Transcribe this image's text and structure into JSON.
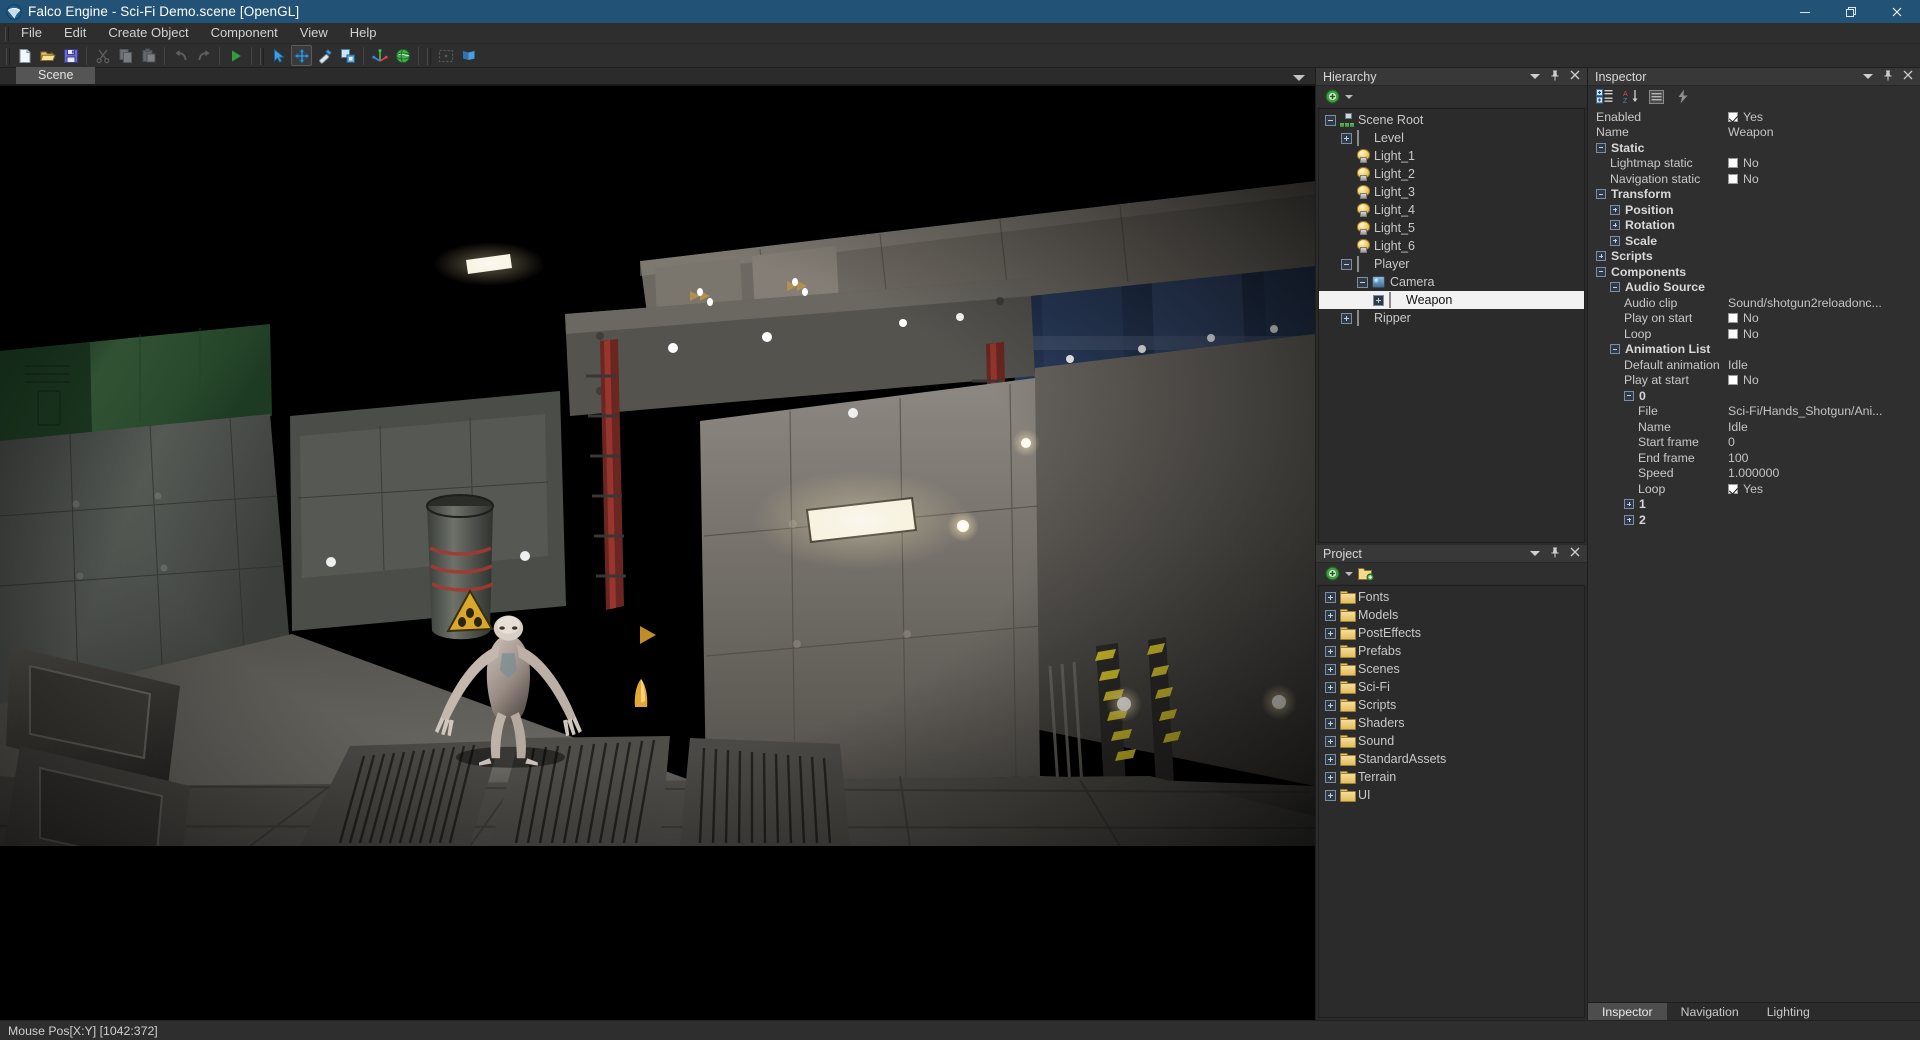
{
  "window": {
    "title": "Falco Engine - Sci-Fi Demo.scene [OpenGL]",
    "logo_icon": "falco-engine-logo-icon",
    "minimize_label": "—",
    "maximize_label": "❐",
    "close_label": "✕",
    "titlebar_color": "#225376"
  },
  "menu": {
    "items": [
      {
        "label": "File"
      },
      {
        "label": "Edit"
      },
      {
        "label": "Create Object"
      },
      {
        "label": "Component"
      },
      {
        "label": "View"
      },
      {
        "label": "Help"
      }
    ]
  },
  "toolbar": {
    "groups": [
      {
        "buttons": [
          {
            "name": "new-scene",
            "icon": "new-document-icon",
            "enabled": true
          },
          {
            "name": "open-scene",
            "icon": "open-folder-icon",
            "enabled": true
          },
          {
            "name": "save-scene",
            "icon": "floppy-save-icon",
            "enabled": true
          }
        ]
      },
      {
        "buttons": [
          {
            "name": "cut",
            "icon": "scissors-icon",
            "enabled": false
          },
          {
            "name": "copy",
            "icon": "copy-icon",
            "enabled": false
          },
          {
            "name": "paste",
            "icon": "paste-icon",
            "enabled": false
          }
        ]
      },
      {
        "buttons": [
          {
            "name": "undo",
            "icon": "undo-arrow-icon",
            "enabled": false
          },
          {
            "name": "redo",
            "icon": "redo-arrow-icon",
            "enabled": false
          }
        ]
      },
      {
        "buttons": [
          {
            "name": "play",
            "icon": "play-triangle-icon",
            "enabled": true
          }
        ]
      },
      {
        "buttons": [
          {
            "name": "select-tool",
            "icon": "cursor-arrow-icon",
            "enabled": true
          },
          {
            "name": "move-tool",
            "icon": "move-arrows-icon",
            "enabled": true,
            "active": true
          },
          {
            "name": "rotate-tool",
            "icon": "rotate-tool-icon",
            "enabled": true
          },
          {
            "name": "scale-tool",
            "icon": "scale-tool-icon",
            "enabled": true
          }
        ]
      },
      {
        "buttons": [
          {
            "name": "pivot-space",
            "icon": "axis-gizmo-icon",
            "enabled": true
          },
          {
            "name": "global-space",
            "icon": "globe-icon",
            "enabled": true
          }
        ]
      },
      {
        "buttons": [
          {
            "name": "rect-select",
            "icon": "marquee-select-icon",
            "enabled": false
          },
          {
            "name": "layers",
            "icon": "flag-icon",
            "enabled": true
          }
        ]
      }
    ]
  },
  "scene": {
    "tabs": [
      {
        "label": "Scene",
        "active": true
      }
    ],
    "dropdown_icon": "chevron-down-icon"
  },
  "hierarchy": {
    "title": "Hierarchy",
    "header_buttons": [
      {
        "name": "panel-menu",
        "icon": "chevron-down-icon"
      },
      {
        "name": "panel-pin",
        "icon": "pin-icon",
        "glyph": "⚐"
      },
      {
        "name": "panel-close",
        "icon": "close-icon",
        "glyph": "✕"
      }
    ],
    "tools": [
      {
        "name": "add-object",
        "icon": "add-green-circle-icon"
      },
      {
        "name": "add-object-menu",
        "icon": "chevron-down-icon"
      }
    ],
    "tree": [
      {
        "label": "Scene Root",
        "indent": 0,
        "toggle": "minus",
        "icon": "scene-root-icon",
        "selected": false
      },
      {
        "label": "Level",
        "indent": 1,
        "toggle": "plus",
        "icon": "gameobject-cube-icon",
        "selected": false
      },
      {
        "label": "Light_1",
        "indent": 1,
        "toggle": "none",
        "icon": "light-bulb-icon",
        "selected": false
      },
      {
        "label": "Light_2",
        "indent": 1,
        "toggle": "none",
        "icon": "light-bulb-icon",
        "selected": false
      },
      {
        "label": "Light_3",
        "indent": 1,
        "toggle": "none",
        "icon": "light-bulb-icon",
        "selected": false
      },
      {
        "label": "Light_4",
        "indent": 1,
        "toggle": "none",
        "icon": "light-bulb-icon",
        "selected": false
      },
      {
        "label": "Light_5",
        "indent": 1,
        "toggle": "none",
        "icon": "light-bulb-icon",
        "selected": false
      },
      {
        "label": "Light_6",
        "indent": 1,
        "toggle": "none",
        "icon": "light-bulb-icon",
        "selected": false
      },
      {
        "label": "Player",
        "indent": 1,
        "toggle": "minus",
        "icon": "gameobject-cube-icon",
        "selected": false
      },
      {
        "label": "Camera",
        "indent": 2,
        "toggle": "minus",
        "icon": "camera-icon",
        "selected": false
      },
      {
        "label": "Weapon",
        "indent": 3,
        "toggle": "plus",
        "icon": "gameobject-cube-icon",
        "selected": true
      },
      {
        "label": "Ripper",
        "indent": 1,
        "toggle": "plus",
        "icon": "gameobject-cube-icon",
        "selected": false
      }
    ]
  },
  "project": {
    "title": "Project",
    "header_buttons": [
      {
        "name": "panel-menu",
        "icon": "chevron-down-icon"
      },
      {
        "name": "panel-pin",
        "icon": "pin-icon",
        "glyph": "⚐"
      },
      {
        "name": "panel-close",
        "icon": "close-icon",
        "glyph": "✕"
      }
    ],
    "tools": [
      {
        "name": "create-asset",
        "icon": "add-green-circle-icon"
      },
      {
        "name": "create-asset-menu",
        "icon": "chevron-down-icon"
      },
      {
        "name": "new-folder",
        "icon": "new-folder-icon"
      }
    ],
    "folders": [
      {
        "label": "Fonts"
      },
      {
        "label": "Models"
      },
      {
        "label": "PostEffects"
      },
      {
        "label": "Prefabs"
      },
      {
        "label": "Scenes"
      },
      {
        "label": "Sci-Fi"
      },
      {
        "label": "Scripts"
      },
      {
        "label": "Shaders"
      },
      {
        "label": "Sound"
      },
      {
        "label": "StandardAssets"
      },
      {
        "label": "Terrain"
      },
      {
        "label": "UI"
      }
    ]
  },
  "inspector": {
    "title": "Inspector",
    "header_buttons": [
      {
        "name": "panel-menu",
        "icon": "chevron-down-icon"
      },
      {
        "name": "panel-pin",
        "icon": "pin-icon",
        "glyph": "⚐"
      },
      {
        "name": "panel-close",
        "icon": "close-icon",
        "glyph": "✕"
      }
    ],
    "tools": [
      {
        "name": "add-component",
        "icon": "add-component-list-icon"
      },
      {
        "name": "sort-properties",
        "icon": "sort-az-icon"
      },
      {
        "name": "category-view",
        "icon": "list-view-icon"
      },
      {
        "name": "quick-actions",
        "icon": "lightning-bolt-icon"
      }
    ],
    "rows": [
      {
        "name": "enabled",
        "label": "Enabled",
        "indent": 0,
        "toggle": "none",
        "type": "checkbox",
        "value": "Yes",
        "checked": true,
        "bold": false
      },
      {
        "name": "object-name",
        "label": "Name",
        "indent": 0,
        "toggle": "none",
        "type": "text",
        "value": "Weapon",
        "bold": false
      },
      {
        "name": "static-group",
        "label": "Static",
        "indent": 0,
        "toggle": "minus",
        "type": "group",
        "value": "",
        "bold": true
      },
      {
        "name": "lightmap-static",
        "label": "Lightmap static",
        "indent": 1,
        "toggle": "none",
        "type": "checkbox",
        "value": "No",
        "checked": false,
        "bold": false
      },
      {
        "name": "navigation-static",
        "label": "Navigation static",
        "indent": 1,
        "toggle": "none",
        "type": "checkbox",
        "value": "No",
        "checked": false,
        "bold": false
      },
      {
        "name": "transform-group",
        "label": "Transform",
        "indent": 0,
        "toggle": "minus",
        "type": "group",
        "value": "",
        "bold": true
      },
      {
        "name": "position",
        "label": "Position",
        "indent": 1,
        "toggle": "plus",
        "type": "group",
        "value": "",
        "bold": true
      },
      {
        "name": "rotation",
        "label": "Rotation",
        "indent": 1,
        "toggle": "plus",
        "type": "group",
        "value": "",
        "bold": true
      },
      {
        "name": "scale",
        "label": "Scale",
        "indent": 1,
        "toggle": "plus",
        "type": "group",
        "value": "",
        "bold": true
      },
      {
        "name": "scripts-group",
        "label": "Scripts",
        "indent": 0,
        "toggle": "plus",
        "type": "group",
        "value": "",
        "bold": true
      },
      {
        "name": "components-group",
        "label": "Components",
        "indent": 0,
        "toggle": "minus",
        "type": "group",
        "value": "",
        "bold": true
      },
      {
        "name": "audio-source-group",
        "label": "Audio Source",
        "indent": 1,
        "toggle": "minus",
        "type": "group",
        "value": "",
        "bold": true
      },
      {
        "name": "audio-clip",
        "label": "Audio clip",
        "indent": 2,
        "toggle": "none",
        "type": "text",
        "value": "Sound/shotgun2reloadonc...",
        "bold": false
      },
      {
        "name": "play-on-start",
        "label": "Play on start",
        "indent": 2,
        "toggle": "none",
        "type": "checkbox",
        "value": "No",
        "checked": false,
        "bold": false
      },
      {
        "name": "audio-loop",
        "label": "Loop",
        "indent": 2,
        "toggle": "none",
        "type": "checkbox",
        "value": "No",
        "checked": false,
        "bold": false
      },
      {
        "name": "animation-list-group",
        "label": "Animation List",
        "indent": 1,
        "toggle": "minus",
        "type": "group",
        "value": "",
        "bold": true
      },
      {
        "name": "default-animation",
        "label": "Default animation",
        "indent": 2,
        "toggle": "none",
        "type": "text",
        "value": "Idle",
        "bold": false
      },
      {
        "name": "play-at-start",
        "label": "Play at start",
        "indent": 2,
        "toggle": "none",
        "type": "checkbox",
        "value": "No",
        "checked": false,
        "bold": false
      },
      {
        "name": "animation-0",
        "label": "0",
        "indent": 2,
        "toggle": "minus",
        "type": "group",
        "value": "",
        "bold": true
      },
      {
        "name": "anim-file",
        "label": "File",
        "indent": 3,
        "toggle": "none",
        "type": "text",
        "value": "Sci-Fi/Hands_Shotgun/Ani...",
        "bold": false
      },
      {
        "name": "anim-name",
        "label": "Name",
        "indent": 3,
        "toggle": "none",
        "type": "text",
        "value": "Idle",
        "bold": false
      },
      {
        "name": "anim-start-frame",
        "label": "Start frame",
        "indent": 3,
        "toggle": "none",
        "type": "text",
        "value": "0",
        "bold": false
      },
      {
        "name": "anim-end-frame",
        "label": "End frame",
        "indent": 3,
        "toggle": "none",
        "type": "text",
        "value": "100",
        "bold": false
      },
      {
        "name": "anim-speed",
        "label": "Speed",
        "indent": 3,
        "toggle": "none",
        "type": "text",
        "value": "1.000000",
        "bold": false
      },
      {
        "name": "anim-loop",
        "label": "Loop",
        "indent": 3,
        "toggle": "none",
        "type": "checkbox",
        "value": "Yes",
        "checked": true,
        "bold": false
      },
      {
        "name": "animation-1",
        "label": "1",
        "indent": 2,
        "toggle": "plus",
        "type": "group",
        "value": "",
        "bold": true
      },
      {
        "name": "animation-2",
        "label": "2",
        "indent": 2,
        "toggle": "plus",
        "type": "group",
        "value": "",
        "bold": true
      }
    ],
    "bottom_tabs": [
      {
        "label": "Inspector",
        "active": true
      },
      {
        "label": "Navigation",
        "active": false
      },
      {
        "label": "Lighting",
        "active": false
      }
    ]
  },
  "statusbar": {
    "text": "Mouse Pos[X:Y] [1042:372]"
  }
}
